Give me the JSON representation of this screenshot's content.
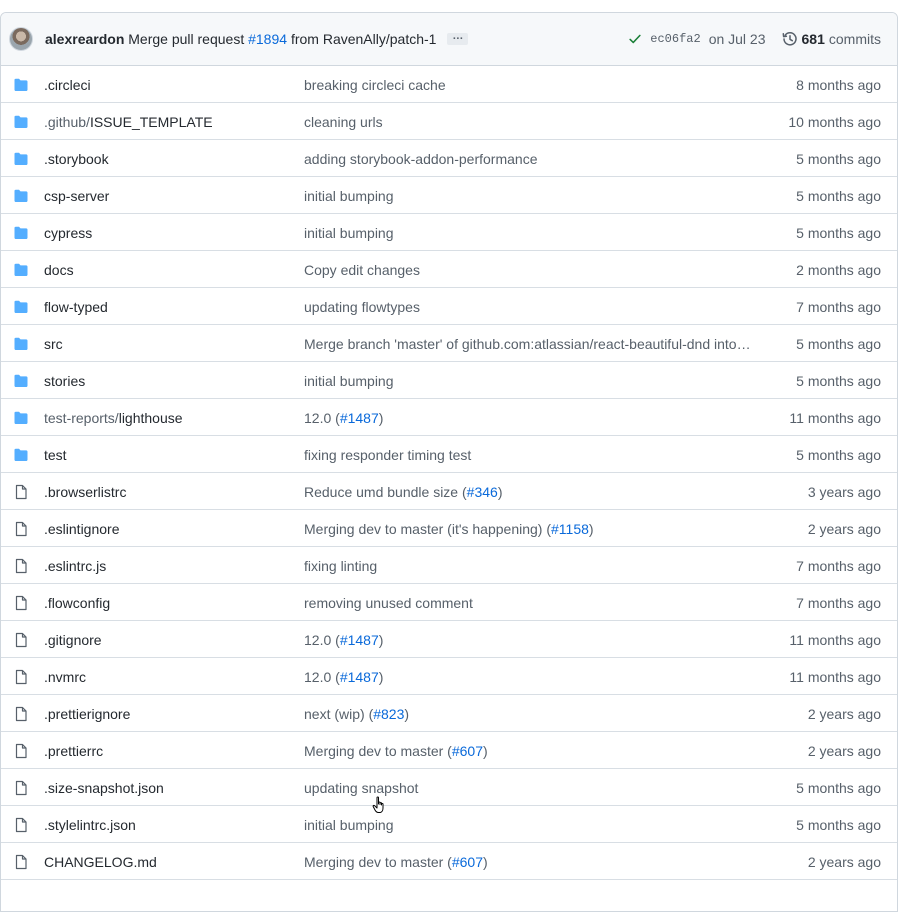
{
  "header": {
    "author": "alexreardon",
    "message_prefix": "Merge pull request",
    "pr": "#1894",
    "message_suffix": "from RavenAlly/patch-1",
    "ellipsis": "…",
    "sha": "ec06fa2",
    "date": "on Jul 23",
    "commit_count": "681",
    "commits_label": "commits",
    "check_color": "#1a7f37"
  },
  "colors": {
    "folder": "#54aeff",
    "link": "#0969da",
    "muted": "#57606a"
  },
  "rows": [
    {
      "type": "folder",
      "prefix": "",
      "name": ".circleci",
      "msg": "breaking circleci cache",
      "pr": "",
      "age": "8 months ago"
    },
    {
      "type": "folder",
      "prefix": ".github/",
      "name": "ISSUE_TEMPLATE",
      "msg": "cleaning urls",
      "pr": "",
      "age": "10 months ago"
    },
    {
      "type": "folder",
      "prefix": "",
      "name": ".storybook",
      "msg": "adding storybook-addon-performance",
      "pr": "",
      "age": "5 months ago"
    },
    {
      "type": "folder",
      "prefix": "",
      "name": "csp-server",
      "msg": "initial bumping",
      "pr": "",
      "age": "5 months ago"
    },
    {
      "type": "folder",
      "prefix": "",
      "name": "cypress",
      "msg": "initial bumping",
      "pr": "",
      "age": "5 months ago"
    },
    {
      "type": "folder",
      "prefix": "",
      "name": "docs",
      "msg": "Copy edit changes",
      "pr": "",
      "age": "2 months ago"
    },
    {
      "type": "folder",
      "prefix": "",
      "name": "flow-typed",
      "msg": "updating flowtypes",
      "pr": "",
      "age": "7 months ago"
    },
    {
      "type": "folder",
      "prefix": "",
      "name": "src",
      "msg": "Merge branch 'master' of github.com:atlassian/react-beautiful-dnd into…",
      "pr": "",
      "age": "5 months ago"
    },
    {
      "type": "folder",
      "prefix": "",
      "name": "stories",
      "msg": "initial bumping",
      "pr": "",
      "age": "5 months ago"
    },
    {
      "type": "folder",
      "prefix": "test-reports/",
      "name": "lighthouse",
      "msg": "12.0 (",
      "pr": "#1487",
      "age": "11 months ago"
    },
    {
      "type": "folder",
      "prefix": "",
      "name": "test",
      "msg": "fixing responder timing test",
      "pr": "",
      "age": "5 months ago"
    },
    {
      "type": "file",
      "prefix": "",
      "name": ".browserlistrc",
      "msg": "Reduce umd bundle size (",
      "pr": "#346",
      "age": "3 years ago"
    },
    {
      "type": "file",
      "prefix": "",
      "name": ".eslintignore",
      "msg": "Merging dev to master (it's happening) (",
      "pr": "#1158",
      "age": "2 years ago"
    },
    {
      "type": "file",
      "prefix": "",
      "name": ".eslintrc.js",
      "msg": "fixing linting",
      "pr": "",
      "age": "7 months ago"
    },
    {
      "type": "file",
      "prefix": "",
      "name": ".flowconfig",
      "msg": "removing unused comment",
      "pr": "",
      "age": "7 months ago"
    },
    {
      "type": "file",
      "prefix": "",
      "name": ".gitignore",
      "msg": "12.0 (",
      "pr": "#1487",
      "age": "11 months ago"
    },
    {
      "type": "file",
      "prefix": "",
      "name": ".nvmrc",
      "msg": "12.0 (",
      "pr": "#1487",
      "age": "11 months ago"
    },
    {
      "type": "file",
      "prefix": "",
      "name": ".prettierignore",
      "msg": "next (wip) (",
      "pr": "#823",
      "age": "2 years ago"
    },
    {
      "type": "file",
      "prefix": "",
      "name": ".prettierrc",
      "msg": "Merging dev to master (",
      "pr": "#607",
      "age": "2 years ago"
    },
    {
      "type": "file",
      "prefix": "",
      "name": ".size-snapshot.json",
      "msg": "updating snapshot",
      "pr": "",
      "age": "5 months ago"
    },
    {
      "type": "file",
      "prefix": "",
      "name": ".stylelintrc.json",
      "msg": "initial bumping",
      "pr": "",
      "age": "5 months ago"
    },
    {
      "type": "file",
      "prefix": "",
      "name": "CHANGELOG.md",
      "msg": "Merging dev to master (",
      "pr": "#607",
      "age": "2 years ago"
    }
  ]
}
